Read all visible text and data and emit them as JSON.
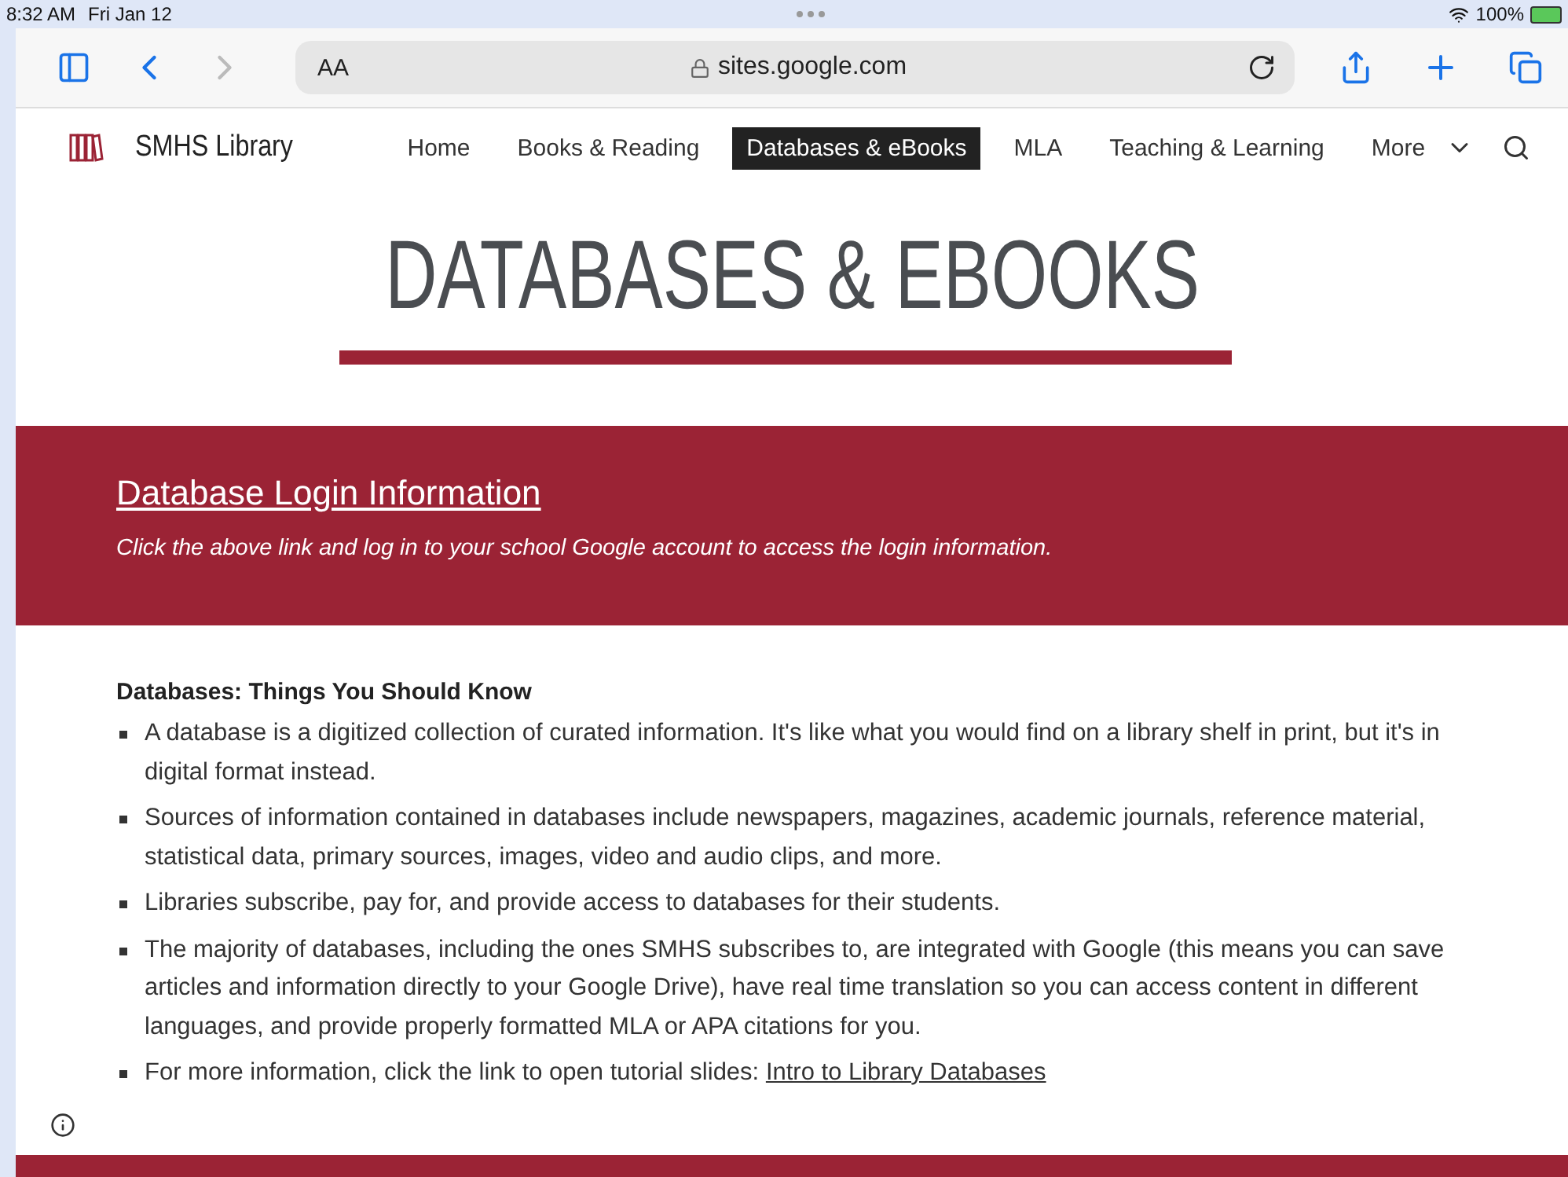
{
  "status_bar": {
    "time": "8:32 AM",
    "date": "Fri Jan 12",
    "battery": "100%"
  },
  "browser": {
    "text_size": "AA",
    "url": "sites.google.com"
  },
  "site": {
    "name": "SMHS Library"
  },
  "nav": [
    {
      "label": "Home",
      "selected": false
    },
    {
      "label": "Books & Reading",
      "selected": false
    },
    {
      "label": "Databases & eBooks",
      "selected": true
    },
    {
      "label": "MLA",
      "selected": false
    },
    {
      "label": "Teaching & Learning",
      "selected": false
    },
    {
      "label": "More",
      "selected": false
    }
  ],
  "page_title": "DATABASES & EBOOKS",
  "banner": {
    "link": "Database Login Information",
    "note": "Click the above link and log in to your school Google account to access the login information."
  },
  "section_heading": "Databases: Things You Should Know",
  "bullets": [
    {
      "text": "A database is a digitized collection of curated information. It's like what you would find on a library shelf in print, but it's in digital format instead."
    },
    {
      "text": "Sources of information contained in databases include newspapers, magazines, academic journals, reference material, statistical data, primary sources, images, video and audio clips, and more."
    },
    {
      "text": "Libraries subscribe, pay for, and provide access to databases for their students."
    },
    {
      "text": "The majority of databases, including the ones SMHS subscribes to, are integrated with Google (this means you can save articles and information directly to your Google Drive), have real time translation so you can access content in different languages, and provide properly formatted MLA or APA citations for you."
    },
    {
      "text": "For more information, click the link to open tutorial slides:",
      "link": "Intro to Library Databases"
    }
  ]
}
